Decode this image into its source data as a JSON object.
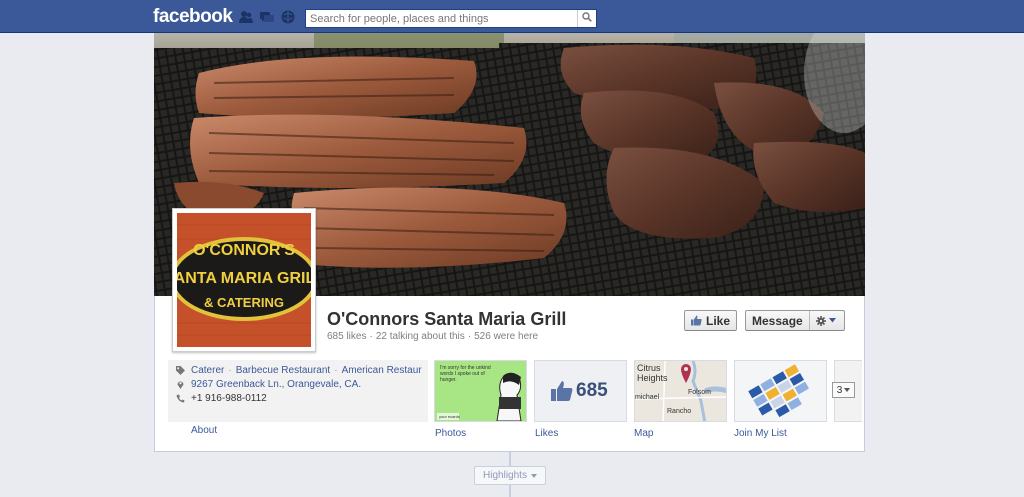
{
  "topbar": {
    "logo": "facebook",
    "search_placeholder": "Search for people, places and things",
    "icons": [
      "friend-requests-icon",
      "messages-icon",
      "notifications-icon",
      "search-icon"
    ]
  },
  "page": {
    "name": "O'Connors Santa Maria Grill",
    "likes": "685 likes",
    "talking": "22 talking about this",
    "were_here": "526 were here",
    "stats_separator": "·",
    "profile_logo_lines": [
      "O'CONNOR'S",
      "SANTA MARIA GRILL",
      "& CATERING"
    ]
  },
  "actions": {
    "like_label": "Like",
    "message_label": "Message"
  },
  "info": {
    "categories": [
      "Caterer",
      "Barbecue Restaurant",
      "American Restaura"
    ],
    "separator": "·",
    "address": "9267 Greenback Ln., Orangevale, CA.",
    "phone": "+1 916-988-0112",
    "about_label": "About"
  },
  "tiles": {
    "photos_label": "Photos",
    "photo_caption": "I'm sorry for the unkind words I spoke out of hunger.",
    "photo_brand": "your ecards",
    "likes_label": "Likes",
    "likes_count": "685",
    "map_label": "Map",
    "map_places": [
      "Citrus Heights",
      "Folsom",
      "michael",
      "Rancho"
    ],
    "joinlist_label": "Join My List",
    "more_count": "3"
  },
  "timeline": {
    "highlights_label": "Highlights"
  },
  "colors": {
    "facebook_blue": "#3b5998",
    "link": "#3b5998",
    "like_thumb": "#5b74a8",
    "profile_red": "#c4512a"
  }
}
